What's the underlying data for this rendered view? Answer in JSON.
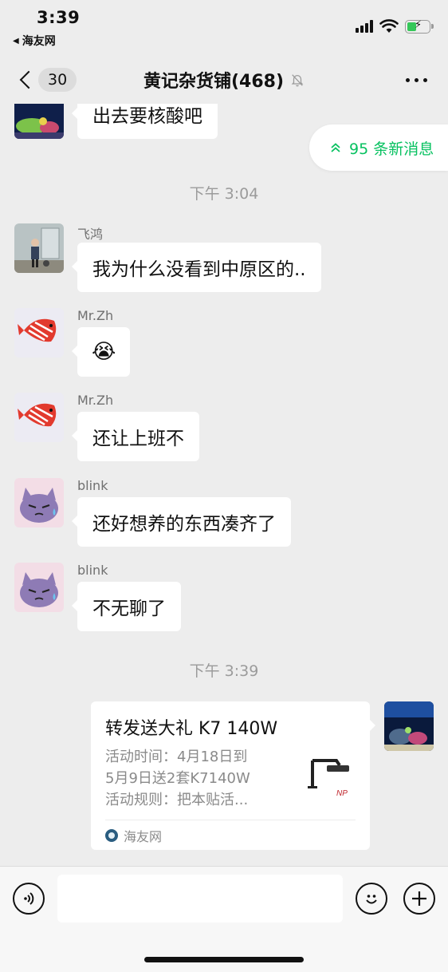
{
  "status_bar": {
    "time": "3:39",
    "back_app": "海友网",
    "battery_color": "#35c759"
  },
  "nav": {
    "unread_count": "30",
    "title": "黄记杂货铺(468)",
    "icons": [
      "chevron-left-icon",
      "mute-bell-icon",
      "more-dots-icon"
    ]
  },
  "new_messages": {
    "label": "95 条新消息",
    "icon": "double-chevron-up-icon",
    "color": "#07c160"
  },
  "messages": [
    {
      "sender": "",
      "text": "出去要核酸吧",
      "avatar": "aquarium-avatar"
    },
    {
      "sender": "飞鸿",
      "text": "我为什么没看到中原区的..",
      "avatar": "child-photo-avatar"
    },
    {
      "sender": "Mr.Zh",
      "text": "😭",
      "avatar": "fish-avatar"
    },
    {
      "sender": "Mr.Zh",
      "text": "还让上班不",
      "avatar": "fish-avatar"
    },
    {
      "sender": "blink",
      "text": "还好想养的东西凑齐了",
      "avatar": "cartoon-cat-avatar"
    },
    {
      "sender": "blink",
      "text": "不无聊了",
      "avatar": "cartoon-cat-avatar"
    }
  ],
  "timestamps": [
    "下午 3:04",
    "下午 3:39"
  ],
  "link_card": {
    "title": "转发送大礼 K7 140W",
    "description": "活动时间：4月18日到\n5月9日送2套K7140W\n活动规则：把本贴活...",
    "source": "海友网",
    "thumb_brand": "NP"
  },
  "input_bar": {
    "placeholder": "",
    "icons": [
      "voice-icon",
      "emoji-icon",
      "plus-icon"
    ]
  }
}
